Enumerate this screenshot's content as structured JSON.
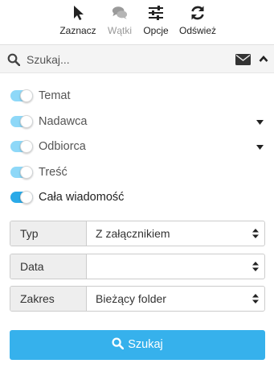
{
  "toolbar": {
    "select_label": "Zaznacz",
    "threads_label": "Wątki",
    "options_label": "Opcje",
    "refresh_label": "Odśwież"
  },
  "search": {
    "placeholder": "Szukaj..."
  },
  "toggles": [
    {
      "label": "Temat",
      "on": true,
      "has_menu": false
    },
    {
      "label": "Nadawca",
      "on": true,
      "has_menu": true
    },
    {
      "label": "Odbiorca",
      "on": true,
      "has_menu": true
    },
    {
      "label": "Treść",
      "on": true,
      "has_menu": false
    },
    {
      "label": "Cała wiadomość",
      "on": true,
      "has_menu": false
    }
  ],
  "filters": [
    {
      "label": "Typ",
      "value": "Z załącznikiem"
    },
    {
      "label": "Data",
      "value": ""
    },
    {
      "label": "Zakres",
      "value": "Bieżący folder"
    }
  ],
  "submit_label": "Szukaj",
  "colors": {
    "accent": "#36b1ec",
    "toggle_light": "#8ed8f8",
    "toggle_active": "#2aaae8"
  }
}
